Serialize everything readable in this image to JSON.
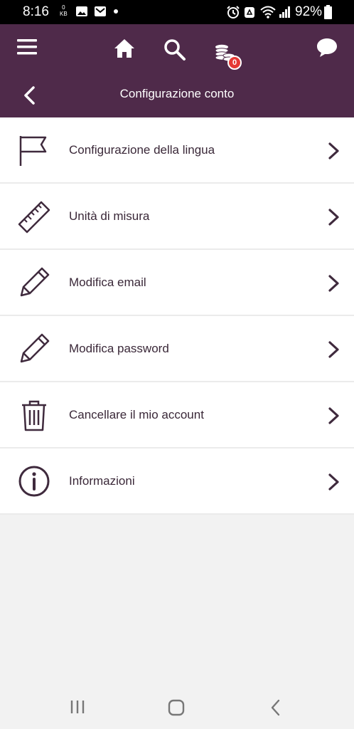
{
  "status_bar": {
    "time": "8:16",
    "data_rate_value": "0",
    "data_rate_unit": "KB",
    "battery": "92%",
    "icons": [
      "image-icon",
      "mail-icon",
      "dot-icon",
      "alarm-icon",
      "recycle-icon",
      "wifi-icon",
      "signal-icon",
      "battery-icon"
    ]
  },
  "header": {
    "icons": [
      "menu-icon",
      "home-icon",
      "search-icon",
      "coins-icon",
      "chat-icon"
    ],
    "coins_badge": "0",
    "title": "Configurazione conto",
    "back_icon": "chevron-left-icon"
  },
  "menu": {
    "items": [
      {
        "label": "Configurazione della lingua",
        "icon": "flag-icon"
      },
      {
        "label": "Unità di misura",
        "icon": "ruler-icon"
      },
      {
        "label": "Modifica email",
        "icon": "pencil-icon"
      },
      {
        "label": "Modifica password",
        "icon": "pencil-icon"
      },
      {
        "label": "Cancellare il mio account",
        "icon": "trash-icon"
      },
      {
        "label": "Informazioni",
        "icon": "info-icon"
      }
    ]
  },
  "colors": {
    "header_bg": "#4f2a4a",
    "icon_color": "#3f2a3d",
    "badge_bg": "#e53935",
    "page_bg": "#f2f2f2"
  },
  "nav_bar": {
    "icons": [
      "recent-apps-icon",
      "home-button-icon",
      "back-button-icon"
    ]
  }
}
